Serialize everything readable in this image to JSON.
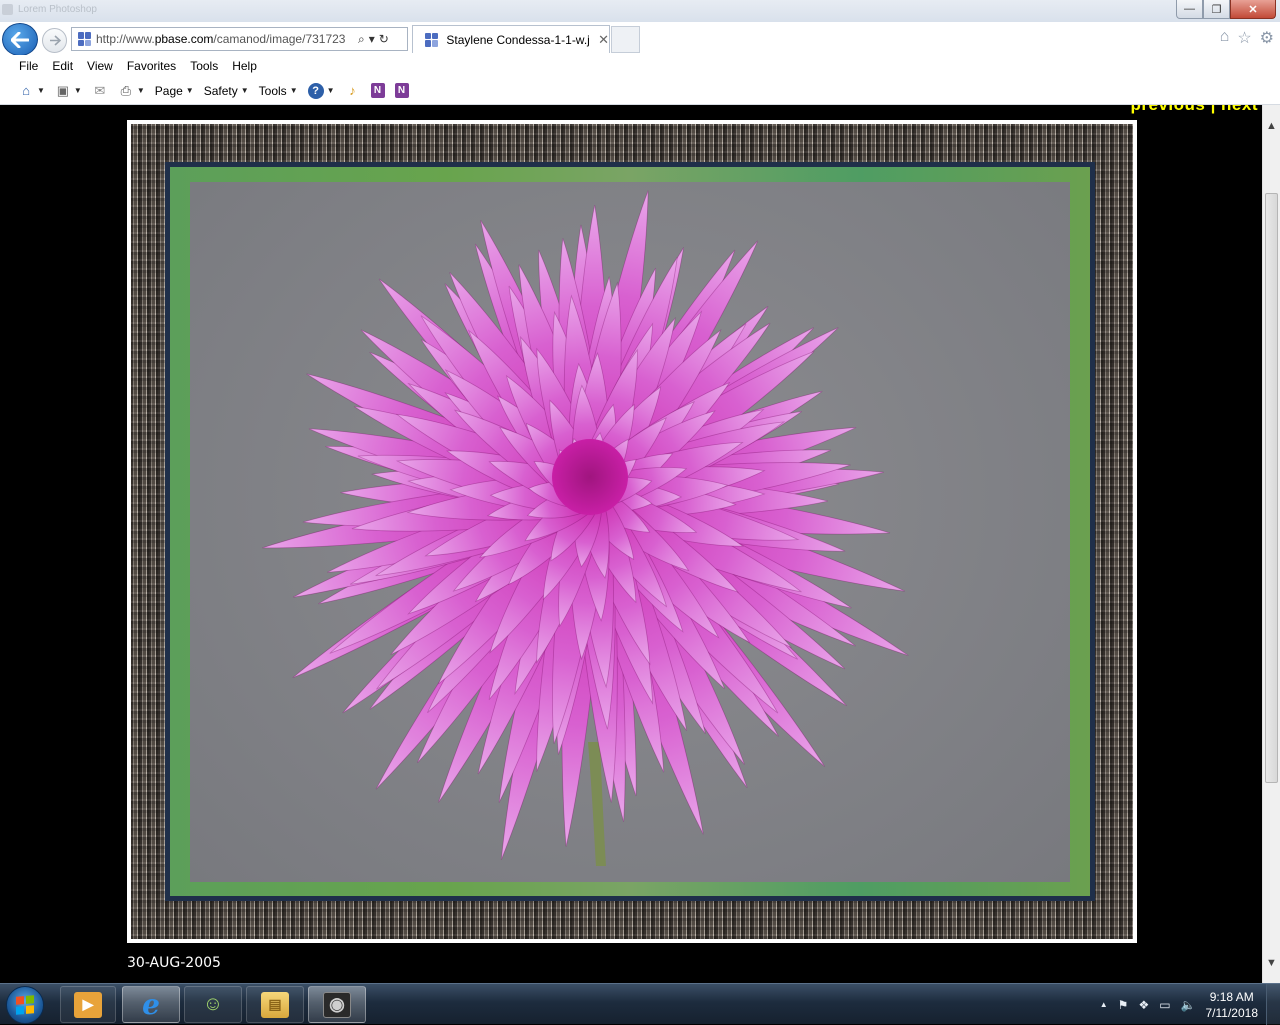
{
  "window": {
    "ghost_title": "Lorem Photoshop",
    "minimize_label": "—",
    "restore_label": "❐",
    "close_label": "✕"
  },
  "navigation": {
    "back_icon": "back-arrow-icon",
    "forward_icon": "forward-arrow-icon",
    "url_prefix": "http://www.",
    "url_domain": "pbase.com",
    "url_path": "/camanod/image/731723",
    "search_glyph": "⌕",
    "dropdown_glyph": "▾",
    "refresh_glyph": "↻"
  },
  "tab": {
    "title": "Staylene Condessa-1-1-w.j...",
    "close_label": "✕"
  },
  "toolbar_right": {
    "home": "⌂",
    "favorites": "☆",
    "settings": "⚙"
  },
  "menu": [
    "File",
    "Edit",
    "View",
    "Favorites",
    "Tools",
    "Help"
  ],
  "command_bar": {
    "page_label": "Page",
    "safety_label": "Safety",
    "tools_label": "Tools",
    "help_glyph": "?",
    "onenote_1": "N",
    "onenote_2": "N"
  },
  "content": {
    "prev_next_text": "previous | next",
    "date": "30-AUG-2005",
    "colors": {
      "flower_core": "#c81fa6",
      "flower_petal": "#d860d0",
      "flower_tip": "#e9a6ea",
      "background": "#000000",
      "link_yellow": "#ffff00"
    }
  },
  "scrollbar": {
    "up_glyph": "▲",
    "down_glyph": "▼"
  },
  "taskbar": {
    "apps": [
      {
        "name": "media-player",
        "glyph": "▶"
      },
      {
        "name": "internet-explorer",
        "glyph": "e"
      },
      {
        "name": "network-people",
        "glyph": "☺"
      },
      {
        "name": "file-explorer",
        "glyph": "▤"
      },
      {
        "name": "photo-viewer",
        "glyph": "◉"
      }
    ],
    "tray": {
      "expand": "▲",
      "flag": "⚑",
      "dropbox": "❖",
      "power": "▭",
      "volume": "🔈"
    },
    "time": "9:18 AM",
    "date": "7/11/2018"
  }
}
